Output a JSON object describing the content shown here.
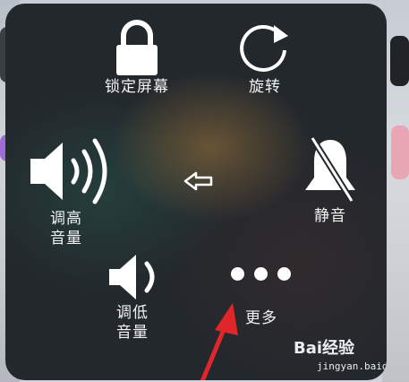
{
  "assistive_touch": {
    "lock_screen": {
      "label": "锁定屏幕",
      "icon": "lock-icon"
    },
    "rotate": {
      "label": "旋转",
      "icon": "rotate-icon"
    },
    "volume_up": {
      "label_line1": "调高",
      "label_line2": "音量",
      "icon": "volume-up-icon"
    },
    "back": {
      "icon": "back-arrow-icon"
    },
    "mute": {
      "label": "静音",
      "icon": "bell-mute-icon"
    },
    "volume_down": {
      "label_line1": "调低",
      "label_line2": "音量",
      "icon": "volume-down-icon"
    },
    "more": {
      "label": "更多",
      "icon": "more-dots-icon"
    }
  },
  "annotation": {
    "icon": "red-pointer-arrow",
    "color": "#e0262b"
  },
  "watermark": {
    "logo_text": "Bai经验",
    "url": "jingyan.baidu.com"
  }
}
